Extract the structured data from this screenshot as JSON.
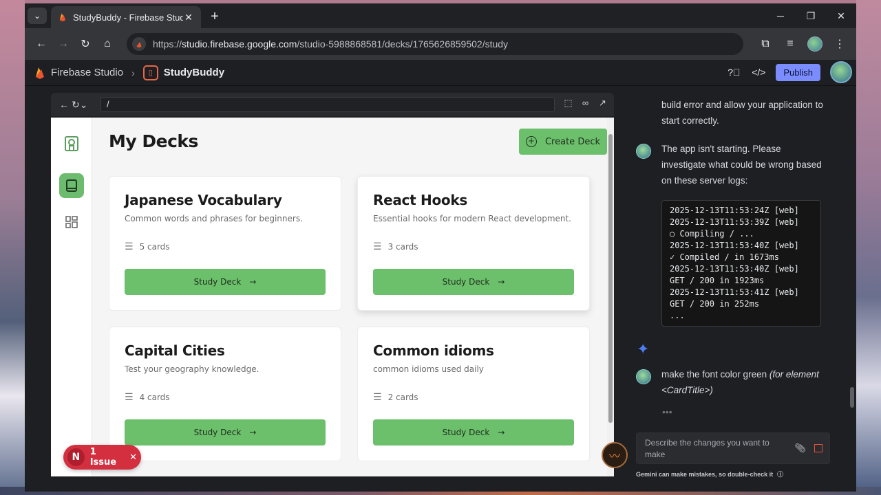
{
  "browser": {
    "tab_title": "StudyBuddy - Firebase Studio",
    "url_host": "studio.firebase.google.com",
    "url_prefix": "https://",
    "url_path": "/studio-5988868581/decks/1765626859502/study"
  },
  "header": {
    "brand": "Firebase Studio",
    "project": "StudyBuddy",
    "publish_label": "Publish"
  },
  "preview": {
    "path": "/"
  },
  "app": {
    "title": "My Decks",
    "create_label": "Create Deck",
    "study_label": "Study Deck",
    "decks": [
      {
        "title": "Japanese Vocabulary",
        "description": "Common words and phrases for beginners.",
        "count": "5 cards"
      },
      {
        "title": "React Hooks",
        "description": "Essential hooks for modern React development.",
        "count": "3 cards"
      },
      {
        "title": "Capital Cities",
        "description": "Test your geography knowledge.",
        "count": "4 cards"
      },
      {
        "title": "Common idioms",
        "description": "common idioms used daily",
        "count": "2 cards"
      }
    ],
    "issue_label": "1 Issue",
    "issue_badge": "N"
  },
  "chat": {
    "prev_tail": "build error and allow your application to start correctly.",
    "user_msg_1": "The app isn't starting. Please investigate what could be wrong based on these server logs:",
    "logs": "2025-12-13T11:53:24Z [web]\n2025-12-13T11:53:39Z [web]\n○ Compiling / ...\n2025-12-13T11:53:40Z [web]\n✓ Compiled / in 1673ms\n2025-12-13T11:53:40Z [web]\nGET / 200 in 1923ms\n2025-12-13T11:53:41Z [web]\nGET / 200 in 252ms\n...",
    "user_msg_2_plain": "make the font color green ",
    "user_msg_2_italic": "(for element <CardTitle>)",
    "input_placeholder": "Describe the changes you want to make",
    "disclaimer": "Gemini can make mistakes, so double-check it"
  },
  "colors": {
    "accent_green": "#6cbf6b",
    "publish": "#7b8cff",
    "issue_red": "#d32f3f"
  }
}
